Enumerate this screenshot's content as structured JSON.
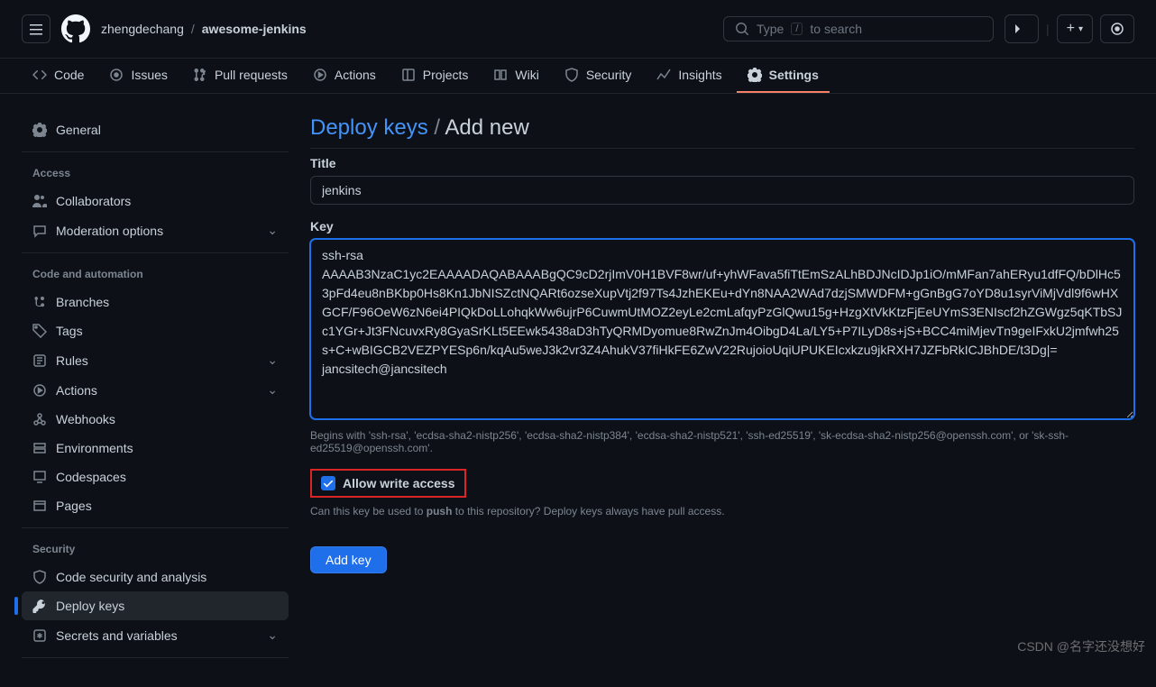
{
  "header": {
    "owner": "zhengdechang",
    "repo": "awesome-jenkins",
    "search_placeholder": "Type",
    "search_suffix": "to search",
    "slash_key": "/"
  },
  "repo_nav": [
    {
      "label": "Code",
      "icon": "code"
    },
    {
      "label": "Issues",
      "icon": "issue"
    },
    {
      "label": "Pull requests",
      "icon": "pr"
    },
    {
      "label": "Actions",
      "icon": "play"
    },
    {
      "label": "Projects",
      "icon": "table"
    },
    {
      "label": "Wiki",
      "icon": "book"
    },
    {
      "label": "Security",
      "icon": "shield"
    },
    {
      "label": "Insights",
      "icon": "graph"
    },
    {
      "label": "Settings",
      "icon": "gear",
      "active": true
    }
  ],
  "sidebar": {
    "general": "General",
    "sections": {
      "access": {
        "title": "Access",
        "items": [
          {
            "label": "Collaborators",
            "icon": "people"
          },
          {
            "label": "Moderation options",
            "icon": "comment",
            "chevron": true
          }
        ]
      },
      "code": {
        "title": "Code and automation",
        "items": [
          {
            "label": "Branches",
            "icon": "branch"
          },
          {
            "label": "Tags",
            "icon": "tag"
          },
          {
            "label": "Rules",
            "icon": "rules",
            "chevron": true
          },
          {
            "label": "Actions",
            "icon": "play",
            "chevron": true
          },
          {
            "label": "Webhooks",
            "icon": "webhook"
          },
          {
            "label": "Environments",
            "icon": "server"
          },
          {
            "label": "Codespaces",
            "icon": "codespaces"
          },
          {
            "label": "Pages",
            "icon": "browser"
          }
        ]
      },
      "security": {
        "title": "Security",
        "items": [
          {
            "label": "Code security and analysis",
            "icon": "shield"
          },
          {
            "label": "Deploy keys",
            "icon": "key",
            "active": true
          },
          {
            "label": "Secrets and variables",
            "icon": "asterisk",
            "chevron": true
          }
        ]
      }
    }
  },
  "page": {
    "title_link": "Deploy keys",
    "title_sep": "/",
    "title_action": "Add new",
    "form": {
      "title_label": "Title",
      "title_value": "jenkins",
      "key_label": "Key",
      "key_value": "ssh-rsa AAAAB3NzaC1yc2EAAAADAQABAAABgQC9cD2rjImV0H1BVF8wr/uf+yhWFava5fiTtEmSzALhBDJNcIDJp1iO/mMFan7ahERyu1dfFQ/bDlHc53pFd4eu8nBKbp0Hs8Kn1JbNISZctNQARt6ozseXupVtj2f97Ts4JzhEKEu+dYn8NAA2WAd7dzjSMWDFM+gGnBgG7oYD8u1syrViMjVdl9f6wHXGCF/F96OeW6zN6ei4PIQkDoLLohqkWw6ujrP6CuwmUtMOZ2eyLe2cmLafqyPzGlQwu15g+HzgXtVkKtzFjEeUYmS3ENIscf2hZGWgz5qKTbSJc1YGr+Jt3FNcuvxRy8GyaSrKLt5EEwk5438aD3hTyQRMDyomue8RwZnJm4OibgD4La/LY5+P7ILyD8s+jS+BCC4miMjevTn9geIFxkU2jmfwh25s+C+wBIGCB2VEZPYESp6n/kqAu5weJ3k2vr3Z4AhukV37fiHkFE6ZwV22RujoioUqiUPUKEIcxkzu9jkRXH7JZFbRkICJBhDE/t3Dg|= jancsitech@jancsitech",
      "key_note": "Begins with 'ssh-rsa', 'ecdsa-sha2-nistp256', 'ecdsa-sha2-nistp384', 'ecdsa-sha2-nistp521', 'ssh-ed25519', 'sk-ecdsa-sha2-nistp256@openssh.com', or 'sk-ssh-ed25519@openssh.com'.",
      "allow_write_label": "Allow write access",
      "allow_write_checked": true,
      "allow_write_note_pre": "Can this key be used to ",
      "allow_write_note_bold": "push",
      "allow_write_note_post": " to this repository? Deploy keys always have pull access.",
      "submit": "Add key"
    }
  },
  "watermark": "CSDN @名字还没想好"
}
